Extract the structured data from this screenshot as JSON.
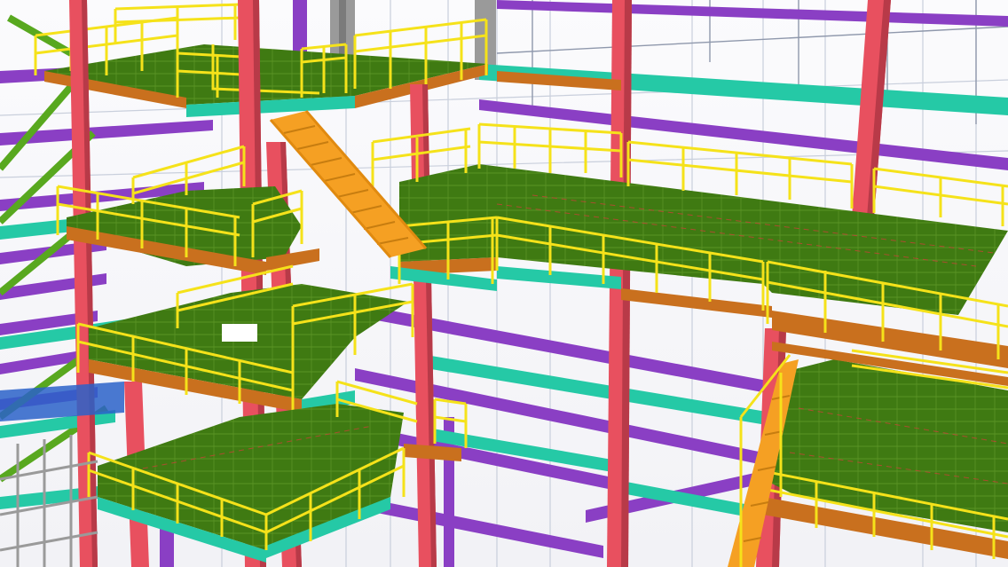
{
  "viewport": {
    "label_text": "",
    "corner_marks": ""
  },
  "colors": {
    "background": "#f4f4f8",
    "column": "#e8505f",
    "column_dark": "#b83a48",
    "beam_teal": "#25c9a6",
    "beam_teal_dark": "#169c80",
    "beam_purple": "#8a3fc4",
    "beam_purple_dark": "#6a2a9a",
    "beam_orange": "#c9701e",
    "floor_grating": "#3f7a12",
    "floor_grating_light": "#4c8c1a",
    "handrail_yellow": "#f5e21a",
    "stair_orange": "#f5a023",
    "bracing_green": "#58a81f",
    "steel_grey": "#9a9a9a",
    "grid_line": "#9aa3b5",
    "grid_line_light": "#c9cfdc",
    "blue_plate": "#2a62c9"
  },
  "icons": []
}
